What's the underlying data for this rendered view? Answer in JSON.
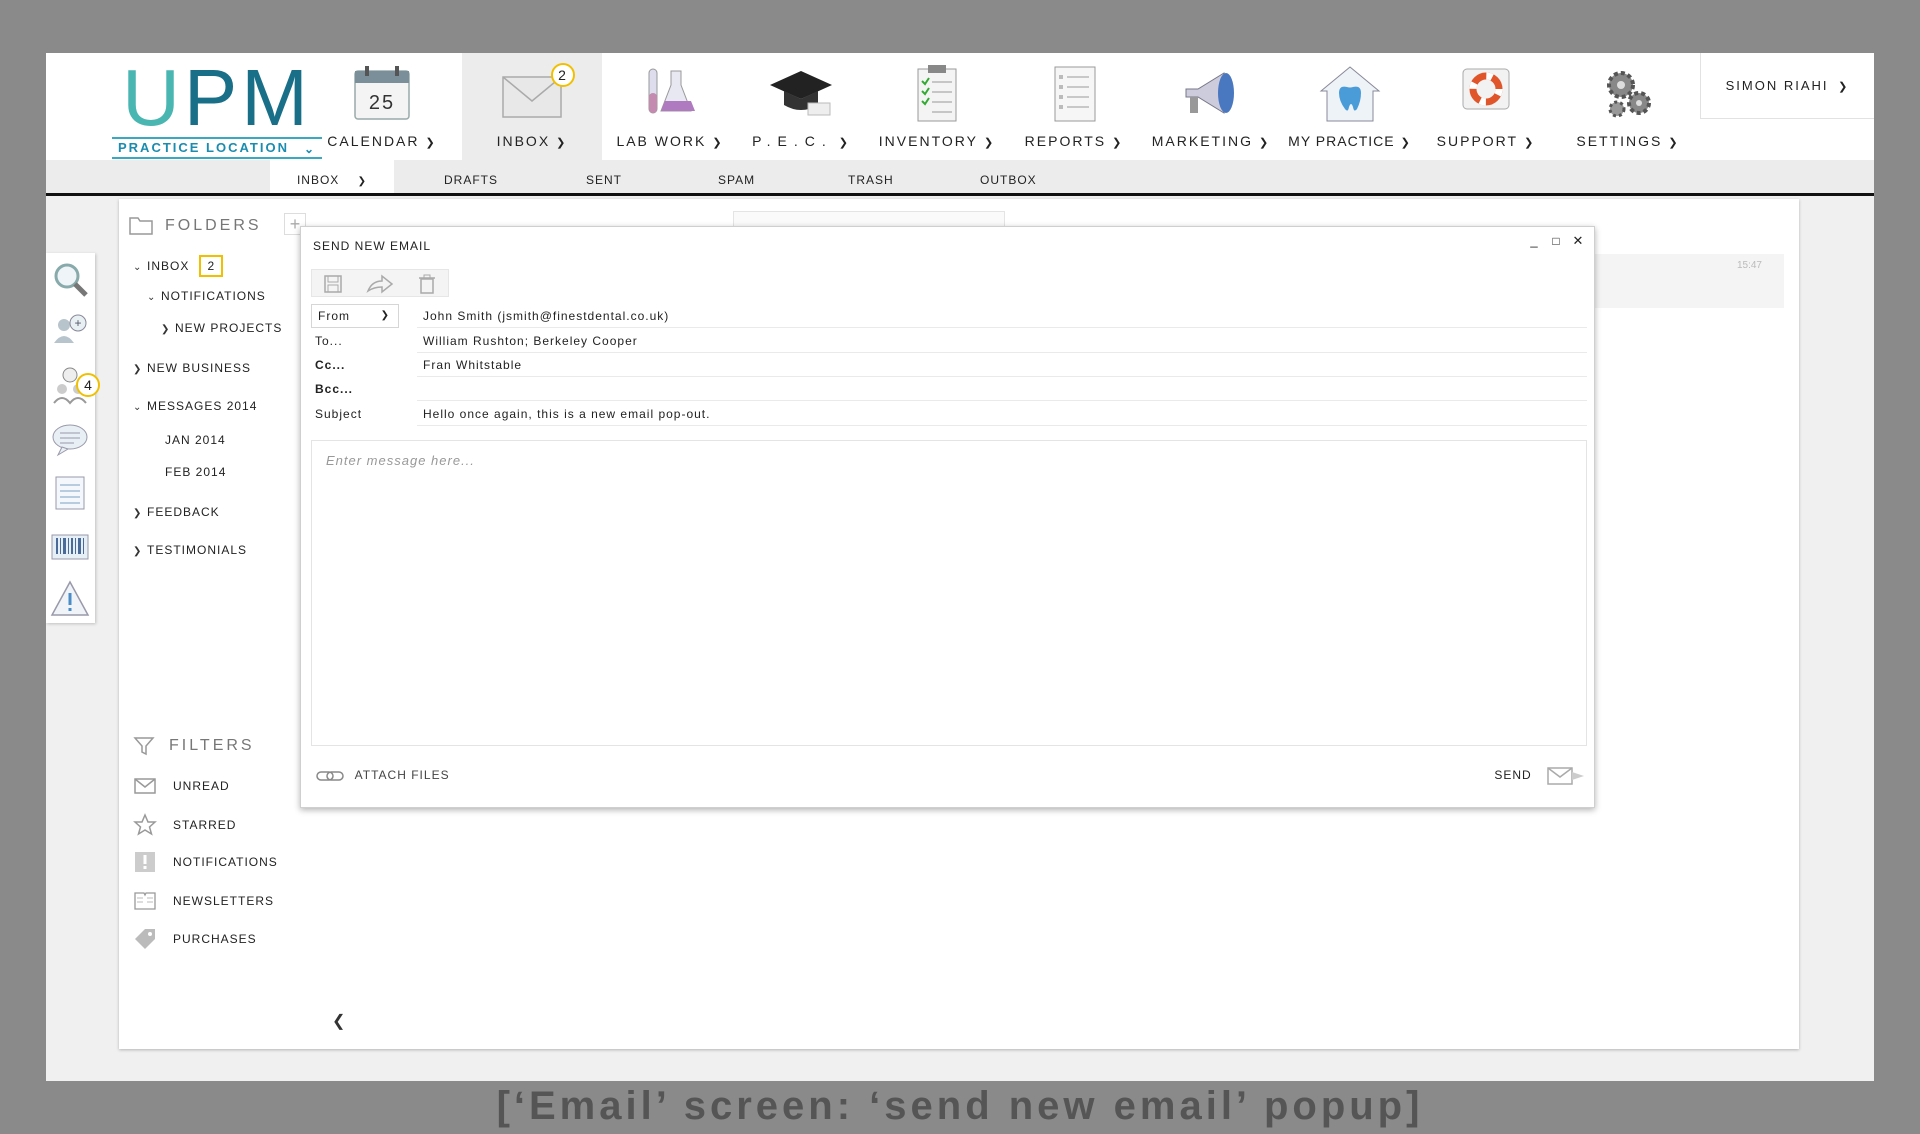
{
  "app": {
    "logo_text": "UPM",
    "location_label": "PRACTICE LOCATION"
  },
  "nav": {
    "items": [
      {
        "label": "CALENDAR",
        "icon": "calendar-icon",
        "calendar_day": "25"
      },
      {
        "label": "INBOX",
        "icon": "envelope-icon",
        "badge": "2",
        "active": true
      },
      {
        "label": "LAB WORK",
        "icon": "lab-flasks-icon"
      },
      {
        "label": "P.E.C.",
        "icon": "graduation-cap-icon"
      },
      {
        "label": "INVENTORY",
        "icon": "clipboard-checklist-icon"
      },
      {
        "label": "REPORTS",
        "icon": "report-list-icon"
      },
      {
        "label": "MARKETING",
        "icon": "megaphone-icon"
      },
      {
        "label": "MY PRACTICE",
        "icon": "tooth-house-icon"
      },
      {
        "label": "SUPPORT",
        "icon": "lifebuoy-icon"
      },
      {
        "label": "SETTINGS",
        "icon": "gears-icon"
      }
    ],
    "user": "SIMON RIAHI"
  },
  "subnav": {
    "items": [
      "INBOX",
      "DRAFTS",
      "SENT",
      "SPAM",
      "TRASH",
      "OUTBOX"
    ],
    "active": "INBOX"
  },
  "tools": {
    "contacts_badge": "4",
    "icons": [
      "search-icon",
      "add-group-icon",
      "contacts-clock-icon",
      "speech-bubble-icon",
      "notes-icon",
      "barcode-icon",
      "warning-icon"
    ]
  },
  "folders": {
    "heading": "FOLDERS",
    "items": [
      {
        "label": "INBOX",
        "badge": "2",
        "level": 0,
        "arrow": "down"
      },
      {
        "label": "NOTIFICATIONS",
        "level": 1,
        "arrow": "down"
      },
      {
        "label": "NEW PROJECTS",
        "level": 2,
        "arrow": "right"
      },
      {
        "label": "NEW BUSINESS",
        "level": 0,
        "arrow": "right"
      },
      {
        "label": "MESSAGES 2014",
        "level": 0,
        "arrow": "down"
      },
      {
        "label": "JAN 2014",
        "level": 1,
        "arrow": ""
      },
      {
        "label": "FEB 2014",
        "level": 1,
        "arrow": ""
      },
      {
        "label": "FEEDBACK",
        "level": 0,
        "arrow": "right"
      },
      {
        "label": "TESTIMONIALS",
        "level": 0,
        "arrow": "right"
      }
    ]
  },
  "filters": {
    "heading": "FILTERS",
    "items": [
      {
        "label": "UNREAD",
        "icon": "envelope-unread-icon"
      },
      {
        "label": "STARRED",
        "icon": "star-icon"
      },
      {
        "label": "NOTIFICATIONS",
        "icon": "exclamation-icon"
      },
      {
        "label": "NEWSLETTERS",
        "icon": "newspaper-icon"
      },
      {
        "label": "PURCHASES",
        "icon": "price-tag-icon"
      }
    ]
  },
  "list": {
    "time": "15:47"
  },
  "popup": {
    "title": "SEND NEW EMAIL",
    "from_label": "From",
    "from_value": "John Smith (jsmith@finestdental.co.uk)",
    "to_label": "To...",
    "to_value": "William Rushton; Berkeley Cooper",
    "cc_label": "Cc...",
    "cc_value": "Fran Whitstable",
    "bcc_label": "Bcc...",
    "bcc_value": "",
    "subject_label": "Subject",
    "subject_value": "Hello once again, this is a new email pop-out.",
    "message_placeholder": "Enter message here...",
    "attach_label": "ATTACH FILES",
    "send_label": "SEND"
  },
  "caption": "[‘Email’ screen: ‘send new email’ popup]",
  "colors": {
    "accent_teal": "#1a6f88",
    "badge_yellow": "#f0c000",
    "background": "#8a8a8a"
  }
}
